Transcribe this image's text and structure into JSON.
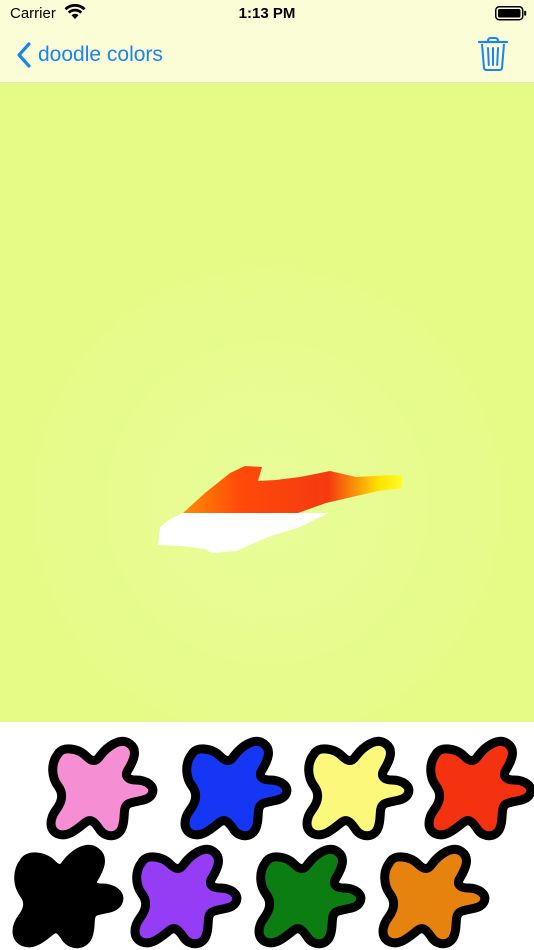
{
  "status_bar": {
    "carrier": "Carrier",
    "time": "1:13 PM"
  },
  "nav": {
    "back_label": "doodle colors",
    "accent_color": "#1a84f0"
  },
  "canvas": {
    "background": "#e5fb85"
  },
  "palette": {
    "colors": [
      {
        "name": "pink",
        "hex": "#f58ed2"
      },
      {
        "name": "blue",
        "hex": "#1536f5"
      },
      {
        "name": "yellow",
        "hex": "#fbf87c"
      },
      {
        "name": "red",
        "hex": "#f5320f"
      },
      {
        "name": "black",
        "hex": "#000000"
      },
      {
        "name": "purple",
        "hex": "#953df5"
      },
      {
        "name": "green",
        "hex": "#0b7d12"
      },
      {
        "name": "orange",
        "hex": "#e6830f"
      }
    ]
  }
}
